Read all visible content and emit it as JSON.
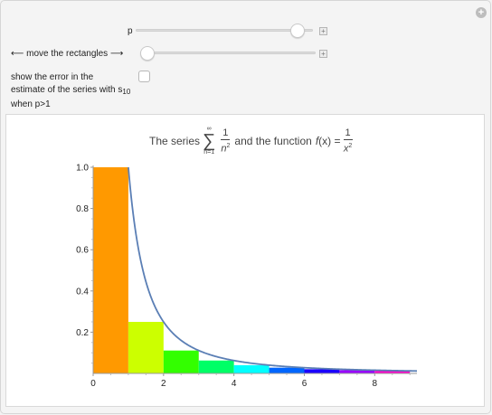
{
  "controls": {
    "p_label": "p",
    "move_label": "⟵ move the rectangles ⟶",
    "error_label_line1": "show the error in the",
    "error_label_line2": "estimate of the series with s",
    "error_label_sub": "10",
    "error_label_line3": "when p>1",
    "p_slider_fraction": 0.95,
    "move_slider_fraction": 0.0,
    "error_checkbox_checked": false,
    "add_icon": "plus-icon"
  },
  "title": {
    "prefix": "The series",
    "sum_upper": "∞",
    "sum_symbol": "∑",
    "sum_lower": "n=1",
    "term_numerator": "1",
    "term_denominator_base": "n",
    "term_denominator_exp": "2",
    "middle": "and the function",
    "func_name": "f",
    "func_arg": "(x) =",
    "func_numerator": "1",
    "func_denominator_base": "x",
    "func_denominator_exp": "2"
  },
  "chart_data": {
    "type": "bar",
    "x_ticks": [
      "0",
      "2",
      "4",
      "6",
      "8"
    ],
    "y_ticks": [
      "0.2",
      "0.4",
      "0.6",
      "0.8",
      "1.0"
    ],
    "xlim": [
      0,
      9.2
    ],
    "ylim": [
      0,
      1.0
    ],
    "rectangles": [
      {
        "x0": 0,
        "x1": 1,
        "height": 1.0,
        "color": "#ff9900"
      },
      {
        "x0": 1,
        "x1": 2,
        "height": 0.25,
        "color": "#ccff00"
      },
      {
        "x0": 2,
        "x1": 3,
        "height": 0.111,
        "color": "#33ff00"
      },
      {
        "x0": 3,
        "x1": 4,
        "height": 0.0625,
        "color": "#00ff66"
      },
      {
        "x0": 4,
        "x1": 5,
        "height": 0.04,
        "color": "#00ffff"
      },
      {
        "x0": 5,
        "x1": 6,
        "height": 0.0278,
        "color": "#0066ff"
      },
      {
        "x0": 6,
        "x1": 7,
        "height": 0.0204,
        "color": "#1a00ff"
      },
      {
        "x0": 7,
        "x1": 8,
        "height": 0.0156,
        "color": "#9900ff"
      },
      {
        "x0": 8,
        "x1": 9,
        "height": 0.0123,
        "color": "#ff00cc"
      }
    ],
    "curve": {
      "expression": "1/x^2",
      "x_start": 1,
      "x_end": 9.2,
      "color": "#5b7fb5"
    }
  }
}
